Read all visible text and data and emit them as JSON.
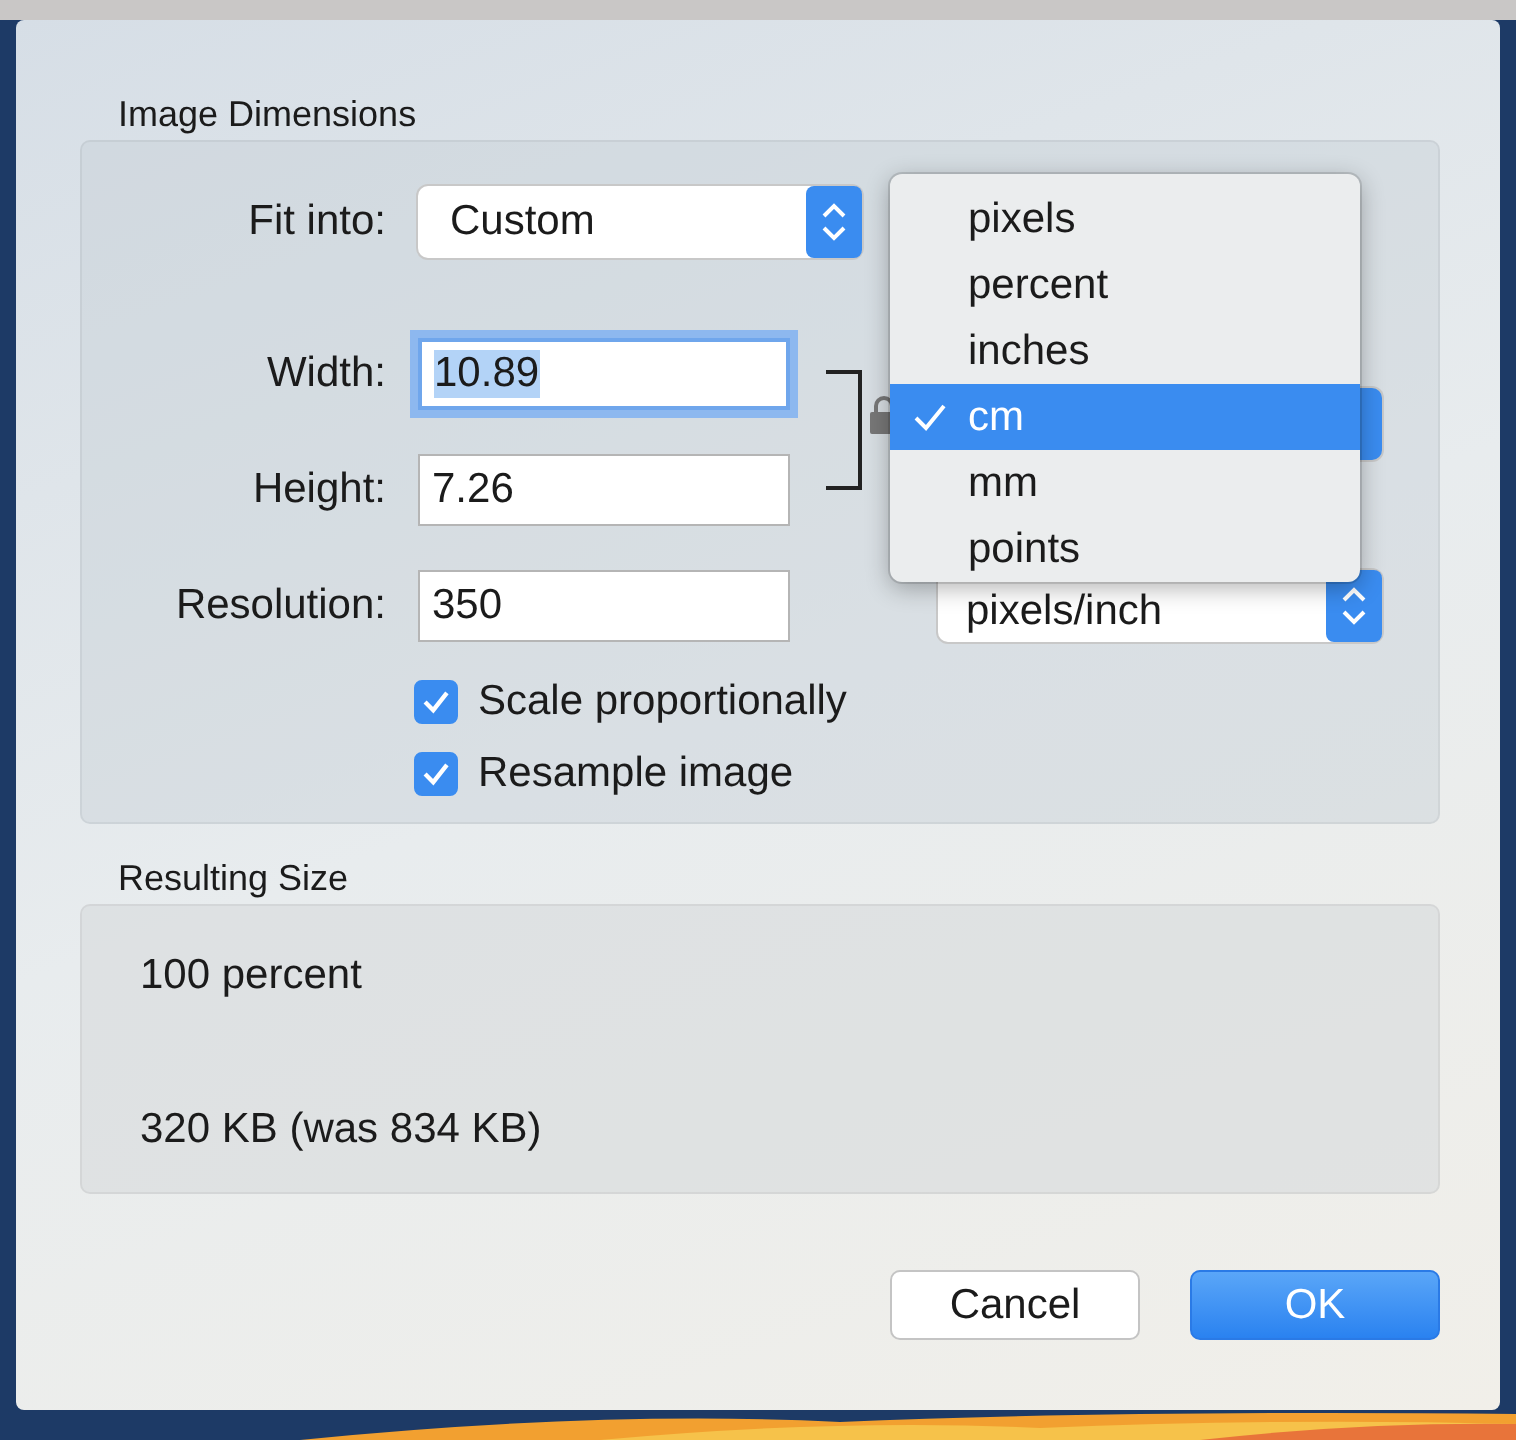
{
  "dialog": {
    "image_dimensions": {
      "title": "Image Dimensions",
      "fit_into": {
        "label": "Fit into:",
        "value": "Custom"
      },
      "fields": [
        {
          "label": "Width:",
          "value": "10.89",
          "focused": true
        },
        {
          "label": "Height:",
          "value": "7.26",
          "focused": false
        },
        {
          "label": "Resolution:",
          "value": "350",
          "focused": false
        }
      ],
      "resolution_unit": "pixels/inch",
      "checkboxes": [
        {
          "label": "Scale proportionally",
          "checked": true
        },
        {
          "label": "Resample image",
          "checked": true
        }
      ]
    },
    "unit_menu": {
      "items": [
        {
          "label": "pixels",
          "selected": false
        },
        {
          "label": "percent",
          "selected": false
        },
        {
          "label": "inches",
          "selected": false
        },
        {
          "label": "cm",
          "selected": true
        },
        {
          "label": "mm",
          "selected": false
        },
        {
          "label": "points",
          "selected": false
        }
      ]
    },
    "resulting_size": {
      "title": "Resulting Size",
      "lines": [
        "100 percent",
        "320 KB (was 834 KB)"
      ]
    },
    "buttons": [
      {
        "label": "Cancel",
        "kind": "secondary"
      },
      {
        "label": "OK",
        "kind": "default"
      }
    ]
  }
}
